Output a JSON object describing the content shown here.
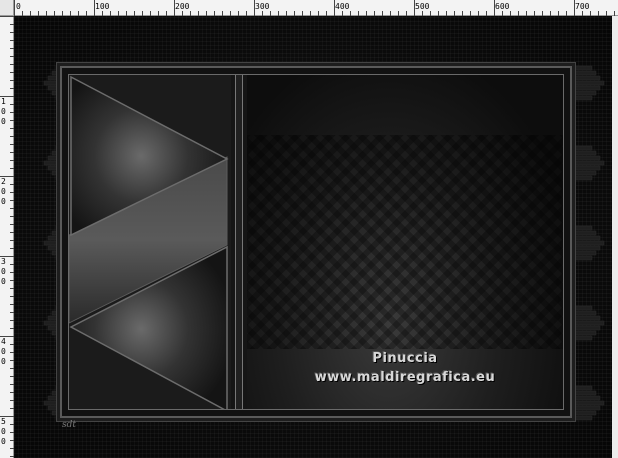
{
  "ruler": {
    "top_labels": [
      "0",
      "100",
      "200",
      "300",
      "400",
      "500",
      "600",
      "700"
    ],
    "left_labels": [
      "1",
      "0",
      "0",
      "2",
      "0",
      "0",
      "3",
      "0",
      "0",
      "4",
      "0",
      "0",
      "5",
      "0",
      "0"
    ]
  },
  "canvas": {
    "watermark": {
      "line1": "Pinuccia",
      "line2": "www.maldiregrafica.eu"
    },
    "signature": "sdt"
  },
  "colors": {
    "background": "#000000",
    "frame": "#5a5a5a",
    "text": "#d8d8d8"
  }
}
